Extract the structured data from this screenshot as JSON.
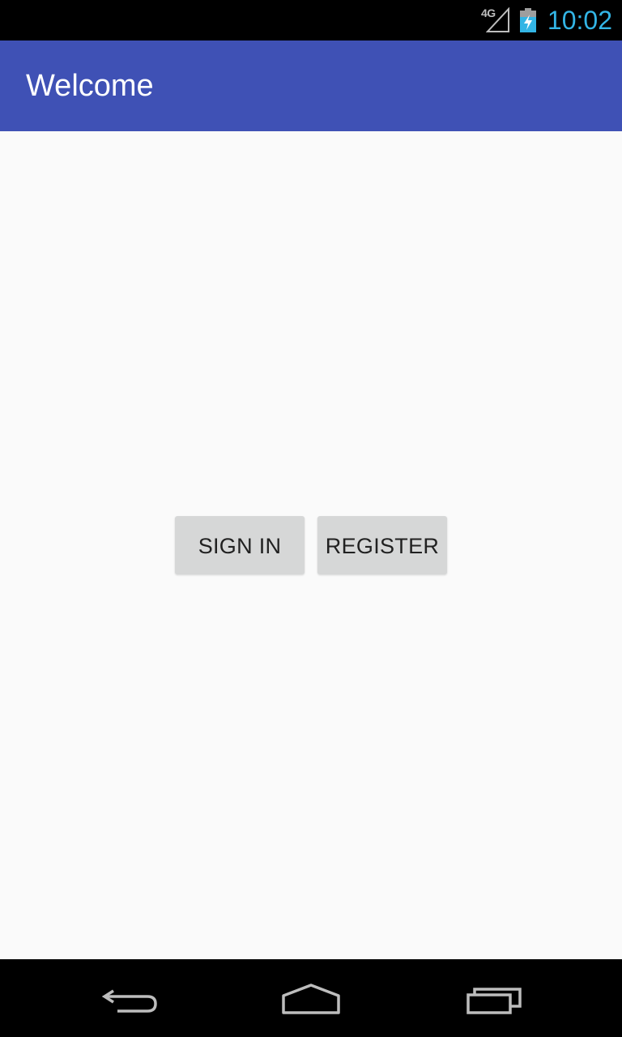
{
  "status_bar": {
    "network": "4G",
    "time": "10:02",
    "time_color": "#33b5e5",
    "icons": [
      "signal-icon",
      "battery-charging-icon"
    ]
  },
  "app_bar": {
    "title": "Welcome",
    "color": "#3f51b5"
  },
  "buttons": {
    "sign_in": "SIGN IN",
    "register": "REGISTER"
  },
  "nav_bar": {
    "icons": [
      "back-icon",
      "home-icon",
      "recents-icon"
    ]
  }
}
